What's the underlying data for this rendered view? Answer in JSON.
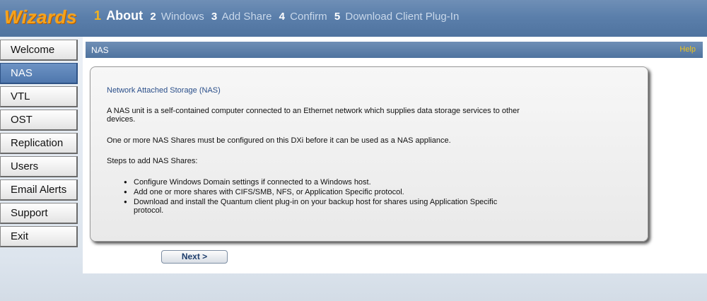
{
  "header": {
    "logo": "Wizards",
    "steps": [
      {
        "num": "1",
        "label": "About"
      },
      {
        "num": "2",
        "label": "Windows"
      },
      {
        "num": "3",
        "label": "Add Share"
      },
      {
        "num": "4",
        "label": "Confirm"
      },
      {
        "num": "5",
        "label": "Download Client Plug-In"
      }
    ],
    "active_step": "1"
  },
  "sidebar": {
    "items": [
      {
        "label": "Welcome"
      },
      {
        "label": "NAS"
      },
      {
        "label": "VTL"
      },
      {
        "label": "OST"
      },
      {
        "label": "Replication"
      },
      {
        "label": "Users"
      },
      {
        "label": "Email Alerts"
      },
      {
        "label": "Support"
      },
      {
        "label": "Exit"
      }
    ],
    "active": "NAS"
  },
  "main": {
    "title": "NAS",
    "help": "Help",
    "panel": {
      "heading": "Network Attached Storage (NAS)",
      "p1": "A NAS unit is a self-contained computer connected to an Ethernet network which supplies data storage services to other devices.",
      "p2": "One or more NAS Shares must be configured on this DXi before it can be used as a NAS appliance.",
      "p3": "Steps to add NAS Shares:",
      "bullets": [
        "Configure Windows Domain settings if connected to a Windows host.",
        "Add one or more shares with CIFS/SMB, NFS, or Application Specific protocol.",
        "Download and install the Quantum client plug-in on your backup host for shares using Application Specific protocol."
      ]
    },
    "next_label": "Next >"
  },
  "colors": {
    "header_blue": "#5b7fab",
    "logo_orange": "#f6a21a",
    "active_nav": "#5a82b8",
    "help_yellow": "#f0c419"
  }
}
